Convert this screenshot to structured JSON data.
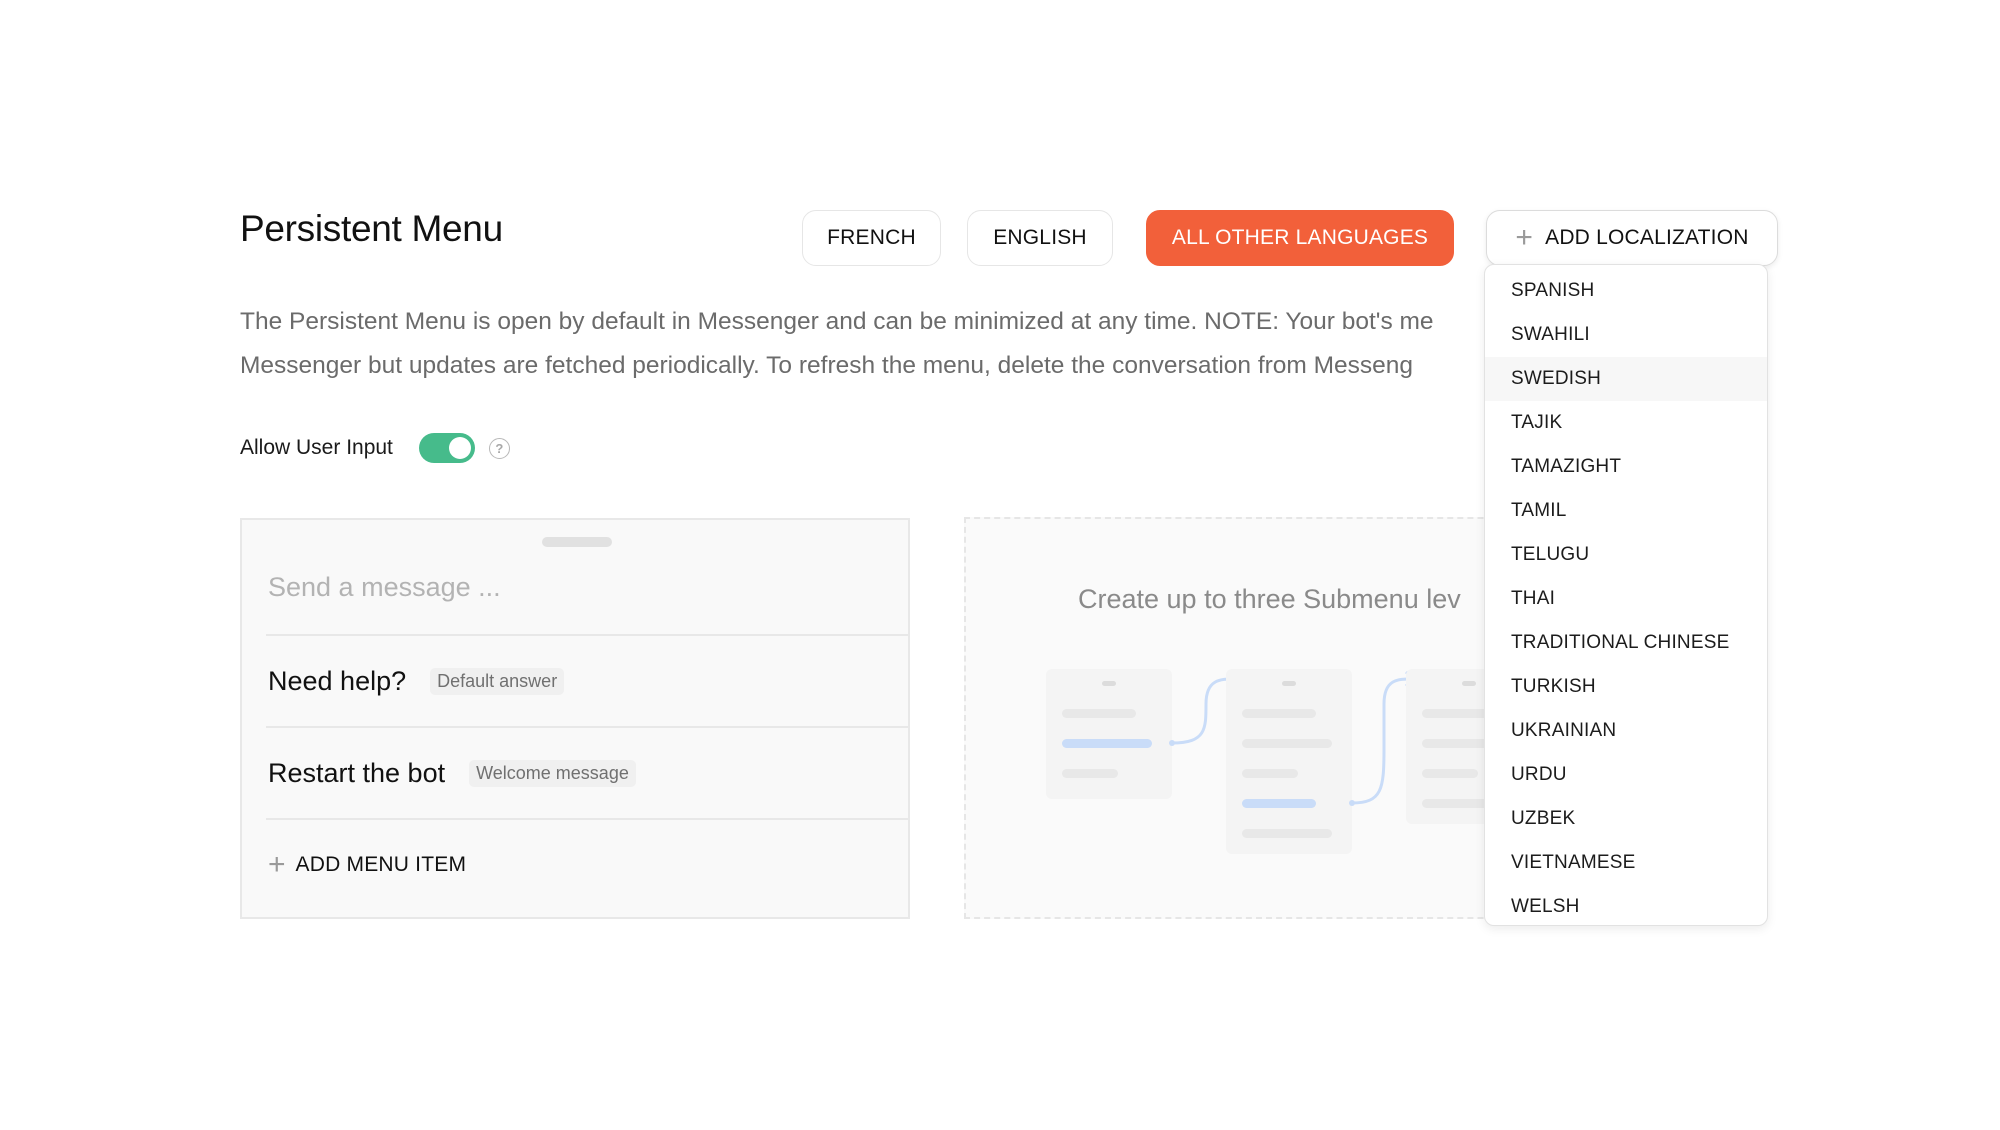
{
  "page": {
    "title": "Persistent Menu",
    "description_line1": "The Persistent Menu is open by default in Messenger and can be minimized at any time. NOTE: Your bot's me",
    "description_line2": "Messenger but updates are fetched periodically. To refresh the menu, delete the conversation from Messeng"
  },
  "language_tabs": [
    {
      "label": "FRENCH",
      "active": false
    },
    {
      "label": "ENGLISH",
      "active": false
    },
    {
      "label": "ALL OTHER LANGUAGES",
      "active": true
    }
  ],
  "add_localization": {
    "label": "ADD LOCALIZATION",
    "icon": "plus-icon",
    "options": [
      "SPANISH",
      "SWAHILI",
      "SWEDISH",
      "TAJIK",
      "TAMAZIGHT",
      "TAMIL",
      "TELUGU",
      "THAI",
      "TRADITIONAL CHINESE",
      "TURKISH",
      "UKRAINIAN",
      "URDU",
      "UZBEK",
      "VIETNAMESE",
      "WELSH"
    ],
    "hovered_option": "SWEDISH"
  },
  "allow_user_input": {
    "label": "Allow User Input",
    "enabled": true,
    "help_icon": "question-circle-icon"
  },
  "menu_preview": {
    "input_placeholder": "Send a message ...",
    "items": [
      {
        "title": "Need help?",
        "badge": "Default answer"
      },
      {
        "title": "Restart the bot",
        "badge": "Welcome message"
      }
    ],
    "add_item_label": "ADD MENU ITEM"
  },
  "submenu_hint": {
    "text": "Create up to three Submenu lev"
  },
  "colors": {
    "accent": "#f2603a",
    "toggle_on": "#46bb8b",
    "illustration_highlight": "#c9dcf8"
  }
}
